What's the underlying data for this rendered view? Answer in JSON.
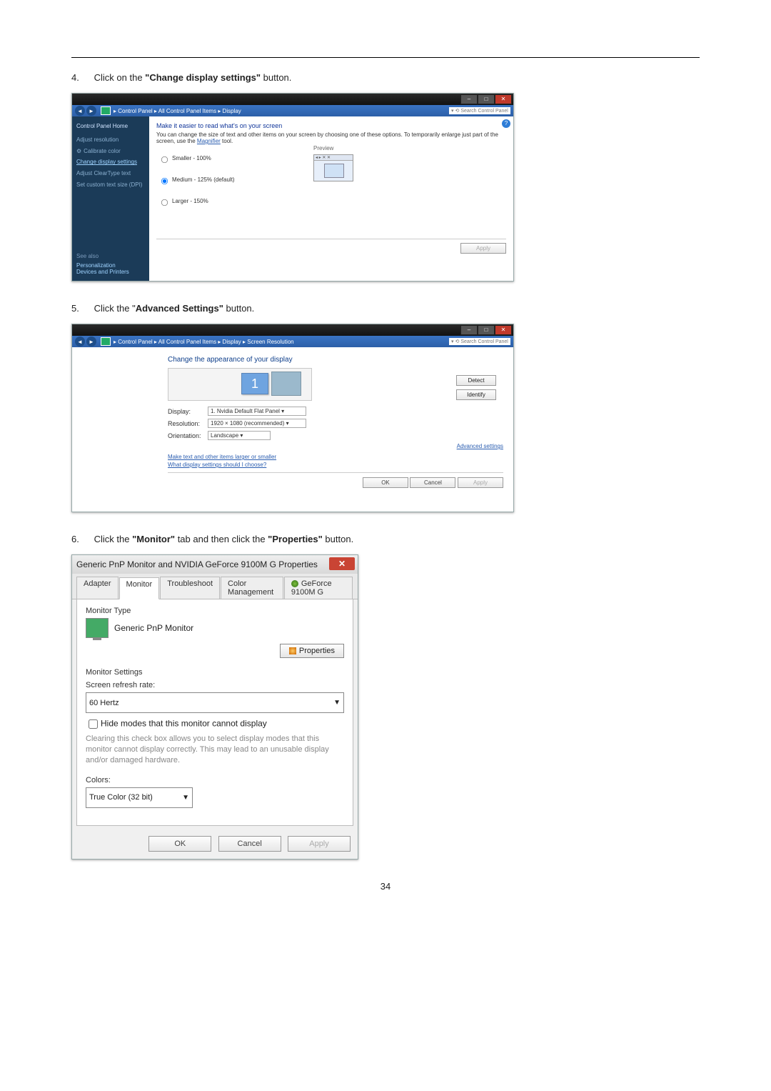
{
  "page_number": "34",
  "steps": [
    {
      "num": "4.",
      "prefix": "Click on the ",
      "bold": "\"Change display settings\"",
      "suffix": " button."
    },
    {
      "num": "5.",
      "prefix": "Click the \"",
      "bold": "Advanced Settings\"",
      "suffix": " button."
    },
    {
      "num": "6.",
      "prefix": "Click the ",
      "bold": "\"Monitor\"",
      "mid": " tab and then click the ",
      "bold2": "\"Properties\"",
      "suffix": " button."
    }
  ],
  "scr1": {
    "breadcrumb": "▸ Control Panel ▸ All Control Panel Items ▸ Display",
    "search_placeholder": "Search Control Panel",
    "sidebar_home": "Control Panel Home",
    "sidebar_items": [
      "Adjust resolution",
      "Calibrate color",
      "Change display settings",
      "Adjust ClearType text",
      "Set custom text size (DPI)"
    ],
    "heading": "Make it easier to read what's on your screen",
    "desc_a": "You can change the size of text and other items on your screen by choosing one of these options. To temporarily enlarge just part of the screen, use the ",
    "desc_link": "Magnifier",
    "desc_b": " tool.",
    "radios": [
      "Smaller - 100%",
      "Medium - 125% (default)",
      "Larger - 150%"
    ],
    "preview_label": "Preview",
    "preview_bar": "◂ ▸ ✕ ✕",
    "apply": "Apply",
    "seealso_head": "See also",
    "seealso_items": [
      "Personalization",
      "Devices and Printers"
    ]
  },
  "scr2": {
    "breadcrumb": "▸ Control Panel ▸ All Control Panel Items ▸ Display ▸ Screen Resolution",
    "search_placeholder": "Search Control Panel",
    "heading": "Change the appearance of your display",
    "detect": "Detect",
    "identify": "Identify",
    "mon1": "1",
    "row_display": "Display:",
    "row_display_val": "1. Nvidia Default Flat Panel ▾",
    "row_res": "Resolution:",
    "row_res_val": "1920 × 1080 (recommended)    ▾",
    "row_orient": "Orientation:",
    "row_orient_val": "Landscape            ▾",
    "adv": "Advanced settings",
    "link1": "Make text and other items larger or smaller",
    "link2": "What display settings should I choose?",
    "ok": "OK",
    "cancel": "Cancel",
    "apply": "Apply"
  },
  "dlg": {
    "title": "Generic PnP Monitor and NVIDIA GeForce 9100M G   Properties",
    "tabs": [
      "Adapter",
      "Monitor",
      "Troubleshoot",
      "Color Management",
      "GeForce 9100M G"
    ],
    "monitor_type": "Monitor Type",
    "monitor_name": "Generic PnP Monitor",
    "properties": "Properties",
    "monitor_settings": "Monitor Settings",
    "refresh_label": "Screen refresh rate:",
    "refresh_val": "60 Hertz",
    "hide_modes": "Hide modes that this monitor cannot display",
    "hide_desc": "Clearing this check box allows you to select display modes that this monitor cannot display correctly. This may lead to an unusable display and/or damaged hardware.",
    "colors_label": "Colors:",
    "colors_val": "True Color (32 bit)",
    "ok": "OK",
    "cancel": "Cancel",
    "apply": "Apply"
  }
}
